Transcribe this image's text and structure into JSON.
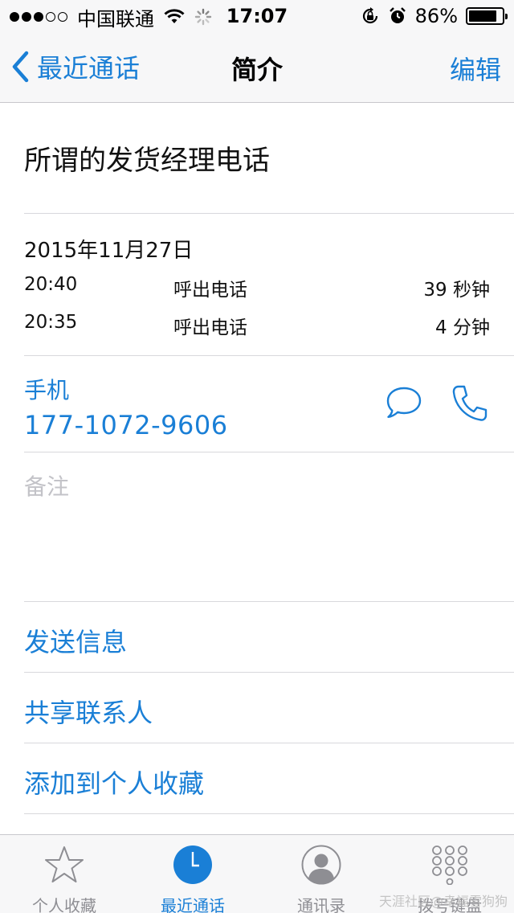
{
  "status_bar": {
    "carrier": "中国联通",
    "time": "17:07",
    "battery_text": "86%",
    "battery_level": 0.86,
    "icons": [
      "signal-dots",
      "wifi-icon",
      "activity-spinner-icon",
      "rotation-lock-icon",
      "alarm-icon",
      "battery-icon"
    ]
  },
  "nav": {
    "back_label": "最近通话",
    "title": "简介",
    "edit_label": "编辑"
  },
  "contact": {
    "name": "所谓的发货经理电话"
  },
  "calls": {
    "date": "2015年11月27日",
    "entries": [
      {
        "time": "20:40",
        "type": "呼出电话",
        "duration": "39 秒钟"
      },
      {
        "time": "20:35",
        "type": "呼出电话",
        "duration": "4 分钟"
      }
    ]
  },
  "phone": {
    "label": "手机",
    "number": "177-1072-9606"
  },
  "notes": {
    "label": "备注"
  },
  "actions": {
    "send_message": "发送信息",
    "share_contact": "共享联系人",
    "add_favorite": "添加到个人收藏"
  },
  "tabs": [
    {
      "label": "个人收藏",
      "icon": "star-icon",
      "active": false
    },
    {
      "label": "最近通话",
      "icon": "clock-icon",
      "active": true
    },
    {
      "label": "通讯录",
      "icon": "contacts-icon",
      "active": false
    },
    {
      "label": "拨号键盘",
      "icon": "keypad-icon",
      "active": false
    }
  ],
  "watermark": "天涯社区@幸福雪狗狗",
  "colors": {
    "accent": "#1a7fd6",
    "bar_background": "#f7f7f8",
    "separator": "#d8d8dc",
    "placeholder": "#c3c3c8",
    "tab_inactive": "#8e8e93"
  }
}
